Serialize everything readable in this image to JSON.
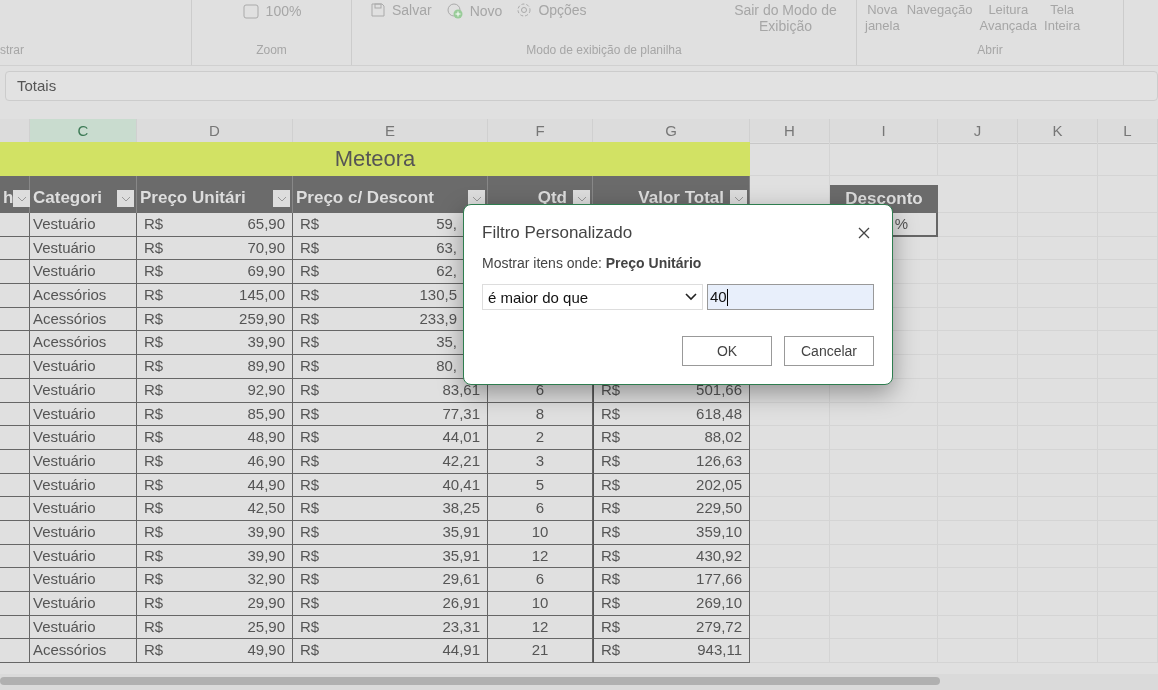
{
  "ribbon": {
    "groups": [
      {
        "label": "strar"
      },
      {
        "label": "Zoom",
        "items": [
          {
            "kind": "zoom",
            "label": "100%"
          }
        ]
      },
      {
        "label": "Modo de exibição de planilha",
        "items": [
          {
            "kind": "save",
            "label": "Salvar"
          },
          {
            "kind": "new",
            "label": "Novo"
          },
          {
            "kind": "gear",
            "label": "Opções"
          },
          {
            "kind": "text",
            "label": "Sair do Modo de Exibição"
          }
        ]
      },
      {
        "label": "Abrir",
        "items": [
          {
            "kind": "text",
            "label": "Nova janela"
          },
          {
            "kind": "text",
            "label": "Navegação"
          },
          {
            "kind": "text",
            "label": "Leitura Avançada"
          },
          {
            "kind": "text",
            "label": "Tela Inteira"
          }
        ]
      }
    ]
  },
  "formula_bar": {
    "value": "Totais"
  },
  "sheet": {
    "column_letters": [
      {
        "label": "C",
        "selected": true
      },
      {
        "label": "D",
        "selected": false
      },
      {
        "label": "E",
        "selected": false
      },
      {
        "label": "F",
        "selected": false
      },
      {
        "label": "G",
        "selected": false
      },
      {
        "label": "H",
        "selected": false
      },
      {
        "label": "I",
        "selected": false
      },
      {
        "label": "J",
        "selected": false
      },
      {
        "label": "K",
        "selected": false
      },
      {
        "label": "L",
        "selected": false
      }
    ],
    "table_title": "Meteora",
    "table_headers": [
      "h",
      "Categori",
      "Preço Unitári",
      "Preço c/ Descont",
      "Qtd",
      "Valor Total"
    ],
    "side_header": "Desconto",
    "side_value": "%",
    "rows": [
      {
        "category": "Vestuário",
        "price_cur": "R$",
        "price": "65,90",
        "disc_cur": "R$",
        "disc": "59,"
      },
      {
        "category": "Vestuário",
        "price_cur": "R$",
        "price": "70,90",
        "disc_cur": "R$",
        "disc": "63,"
      },
      {
        "category": "Vestuário",
        "price_cur": "R$",
        "price": "69,90",
        "disc_cur": "R$",
        "disc": "62,"
      },
      {
        "category": "Acessórios",
        "price_cur": "R$",
        "price": "145,00",
        "disc_cur": "R$",
        "disc": "130,5"
      },
      {
        "category": "Acessórios",
        "price_cur": "R$",
        "price": "259,90",
        "disc_cur": "R$",
        "disc": "233,9"
      },
      {
        "category": "Acessórios",
        "price_cur": "R$",
        "price": "39,90",
        "disc_cur": "R$",
        "disc": "35,"
      },
      {
        "category": "Vestuário",
        "price_cur": "R$",
        "price": "89,90",
        "disc_cur": "R$",
        "disc": "80,"
      },
      {
        "category": "Vestuário",
        "price_cur": "R$",
        "price": "92,90",
        "disc_cur": "R$",
        "disc": "83,61",
        "qty": "6",
        "total_cur": "R$",
        "total": "501,66"
      },
      {
        "category": "Vestuário",
        "price_cur": "R$",
        "price": "85,90",
        "disc_cur": "R$",
        "disc": "77,31",
        "qty": "8",
        "total_cur": "R$",
        "total": "618,48"
      },
      {
        "category": "Vestuário",
        "price_cur": "R$",
        "price": "48,90",
        "disc_cur": "R$",
        "disc": "44,01",
        "qty": "2",
        "total_cur": "R$",
        "total": "88,02"
      },
      {
        "category": "Vestuário",
        "price_cur": "R$",
        "price": "46,90",
        "disc_cur": "R$",
        "disc": "42,21",
        "qty": "3",
        "total_cur": "R$",
        "total": "126,63"
      },
      {
        "category": "Vestuário",
        "price_cur": "R$",
        "price": "44,90",
        "disc_cur": "R$",
        "disc": "40,41",
        "qty": "5",
        "total_cur": "R$",
        "total": "202,05"
      },
      {
        "category": "Vestuário",
        "price_cur": "R$",
        "price": "42,50",
        "disc_cur": "R$",
        "disc": "38,25",
        "qty": "6",
        "total_cur": "R$",
        "total": "229,50"
      },
      {
        "category": "Vestuário",
        "price_cur": "R$",
        "price": "39,90",
        "disc_cur": "R$",
        "disc": "35,91",
        "qty": "10",
        "total_cur": "R$",
        "total": "359,10"
      },
      {
        "category": "Vestuário",
        "price_cur": "R$",
        "price": "39,90",
        "disc_cur": "R$",
        "disc": "35,91",
        "qty": "12",
        "total_cur": "R$",
        "total": "430,92"
      },
      {
        "category": "Vestuário",
        "price_cur": "R$",
        "price": "32,90",
        "disc_cur": "R$",
        "disc": "29,61",
        "qty": "6",
        "total_cur": "R$",
        "total": "177,66"
      },
      {
        "category": "Vestuário",
        "price_cur": "R$",
        "price": "29,90",
        "disc_cur": "R$",
        "disc": "26,91",
        "qty": "10",
        "total_cur": "R$",
        "total": "269,10"
      },
      {
        "category": "Vestuário",
        "price_cur": "R$",
        "price": "25,90",
        "disc_cur": "R$",
        "disc": "23,31",
        "qty": "12",
        "total_cur": "R$",
        "total": "279,72"
      },
      {
        "category": "Acessórios",
        "price_cur": "R$",
        "price": "49,90",
        "disc_cur": "R$",
        "disc": "44,91",
        "qty": "21",
        "total_cur": "R$",
        "total": "943,11"
      }
    ]
  },
  "dialog": {
    "title": "Filtro Personalizado",
    "prompt": "Mostrar itens onde: **Preço Unitário**",
    "condition": "é maior do que",
    "value": "40",
    "buttons": [
      "OK",
      "Cancelar"
    ]
  }
}
